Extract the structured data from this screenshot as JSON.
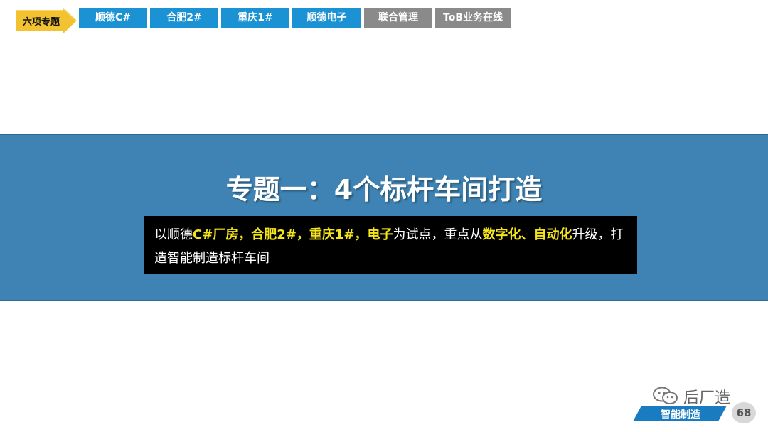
{
  "nav": {
    "section_label": "六项专题",
    "tabs": [
      {
        "label": "顺德C#",
        "state": "blue"
      },
      {
        "label": "合肥2#",
        "state": "blue"
      },
      {
        "label": "重庆1#",
        "state": "blue"
      },
      {
        "label": "顺德电子",
        "state": "blue"
      },
      {
        "label": "联合管理",
        "state": "gray"
      },
      {
        "label": "ToB业务在线",
        "state": "gray"
      }
    ]
  },
  "band": {
    "title": "专题一：4个标杆车间打造"
  },
  "description": {
    "p1": "以顺德",
    "h1": "C#厂房，合肥2#，重庆1#，电子",
    "p2": "为试点，重点从",
    "h2": "数字化、自动化",
    "p3": "升级，打造智能制造标杆车间"
  },
  "footer": {
    "brand": "后厂造",
    "tag": "智能制造",
    "page_number": "68"
  },
  "colors": {
    "tab_blue": "#1a92d4",
    "tab_gray": "#8a8a8a",
    "band": "#3e83b3",
    "highlight": "#f4e51a",
    "label_gold": "#f2c230"
  }
}
